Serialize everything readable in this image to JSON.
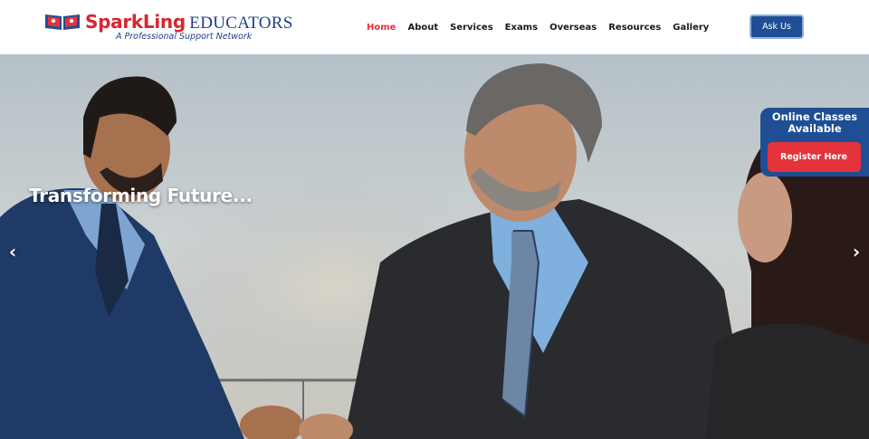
{
  "brand": {
    "name_part1": "SparkLing",
    "name_part2": "EDUCATORS",
    "tagline": "A Professional Support Network"
  },
  "nav": {
    "items": [
      {
        "label": "Home",
        "active": true
      },
      {
        "label": "About",
        "active": false
      },
      {
        "label": "Services",
        "active": false
      },
      {
        "label": "Exams",
        "active": false
      },
      {
        "label": "Overseas",
        "active": false
      },
      {
        "label": "Resources",
        "active": false
      },
      {
        "label": "Gallery",
        "active": false
      }
    ],
    "cta_label": "Ask Us"
  },
  "hero": {
    "heading": "Transforming Future...",
    "prev_icon": "‹",
    "next_icon": "›"
  },
  "side_panel": {
    "title": "Online Classes Available",
    "button_label": "Register Here"
  },
  "colors": {
    "brand_red": "#e5333b",
    "brand_blue": "#1f4e95",
    "nav_text": "#1a1a1a"
  },
  "icons": [
    "open-book-icon",
    "chevron-left-icon",
    "chevron-right-icon"
  ]
}
